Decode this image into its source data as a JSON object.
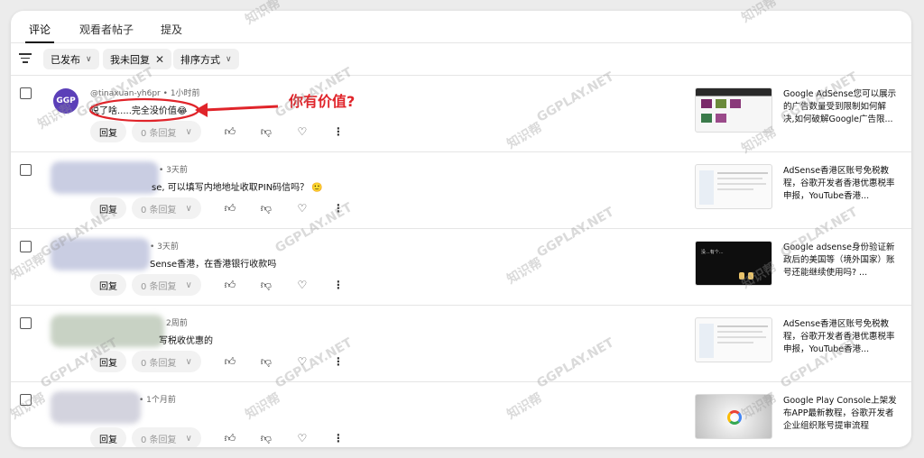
{
  "tabs": [
    {
      "label": "评论",
      "active": true
    },
    {
      "label": "观看者帖子",
      "active": false
    },
    {
      "label": "提及",
      "active": false
    }
  ],
  "filters": {
    "published": "已发布",
    "unreplied": "我未回复",
    "sort": "排序方式"
  },
  "actions": {
    "reply": "回复",
    "replies_count": "0 条回复"
  },
  "comments": [
    {
      "author": "@tinaxuan-yh6pr",
      "time": "1小时前",
      "text": "说了啥.....完全没价值😂",
      "video_title": "Google AdSense您可以展示的广告数量受到限制如何解决,如何破解Google广告限..."
    },
    {
      "author": "",
      "time": "3天前",
      "text": "se, 可以填写内地地址收取PIN码信吗？ 🙂",
      "video_title": "AdSense香港区账号免税教程，谷歌开发者香港优惠税率申报，YouTube香港..."
    },
    {
      "author": "",
      "time": "3天前",
      "text": "Sense香港，在香港银行收款吗",
      "video_title": "Google adsense身份验证新政后的美国等（境外国家）账号还能继续使用吗? ..."
    },
    {
      "author": "",
      "time": "2周前",
      "text": "写税收优惠的",
      "video_title": "AdSense香港区账号免税教程，谷歌开发者香港优惠税率申报，YouTube香港..."
    },
    {
      "author": "",
      "time": "1个月前",
      "text": "",
      "video_title": "Google Play Console上架发布APP最新教程，谷歌开发者企业组织账号提审流程"
    }
  ],
  "annotation": {
    "text": "你有价值?",
    "color": "#e0242a"
  },
  "thumb3_text": "没...有个...",
  "watermarks": {
    "a": "知识帮",
    "b": "GGPLAY.NET"
  },
  "icons": {
    "thumb_up": "thumbs-up-icon",
    "thumb_down": "thumbs-down-icon",
    "heart": "heart-icon",
    "more": "more-vert-icon",
    "filter": "filter-icon"
  }
}
